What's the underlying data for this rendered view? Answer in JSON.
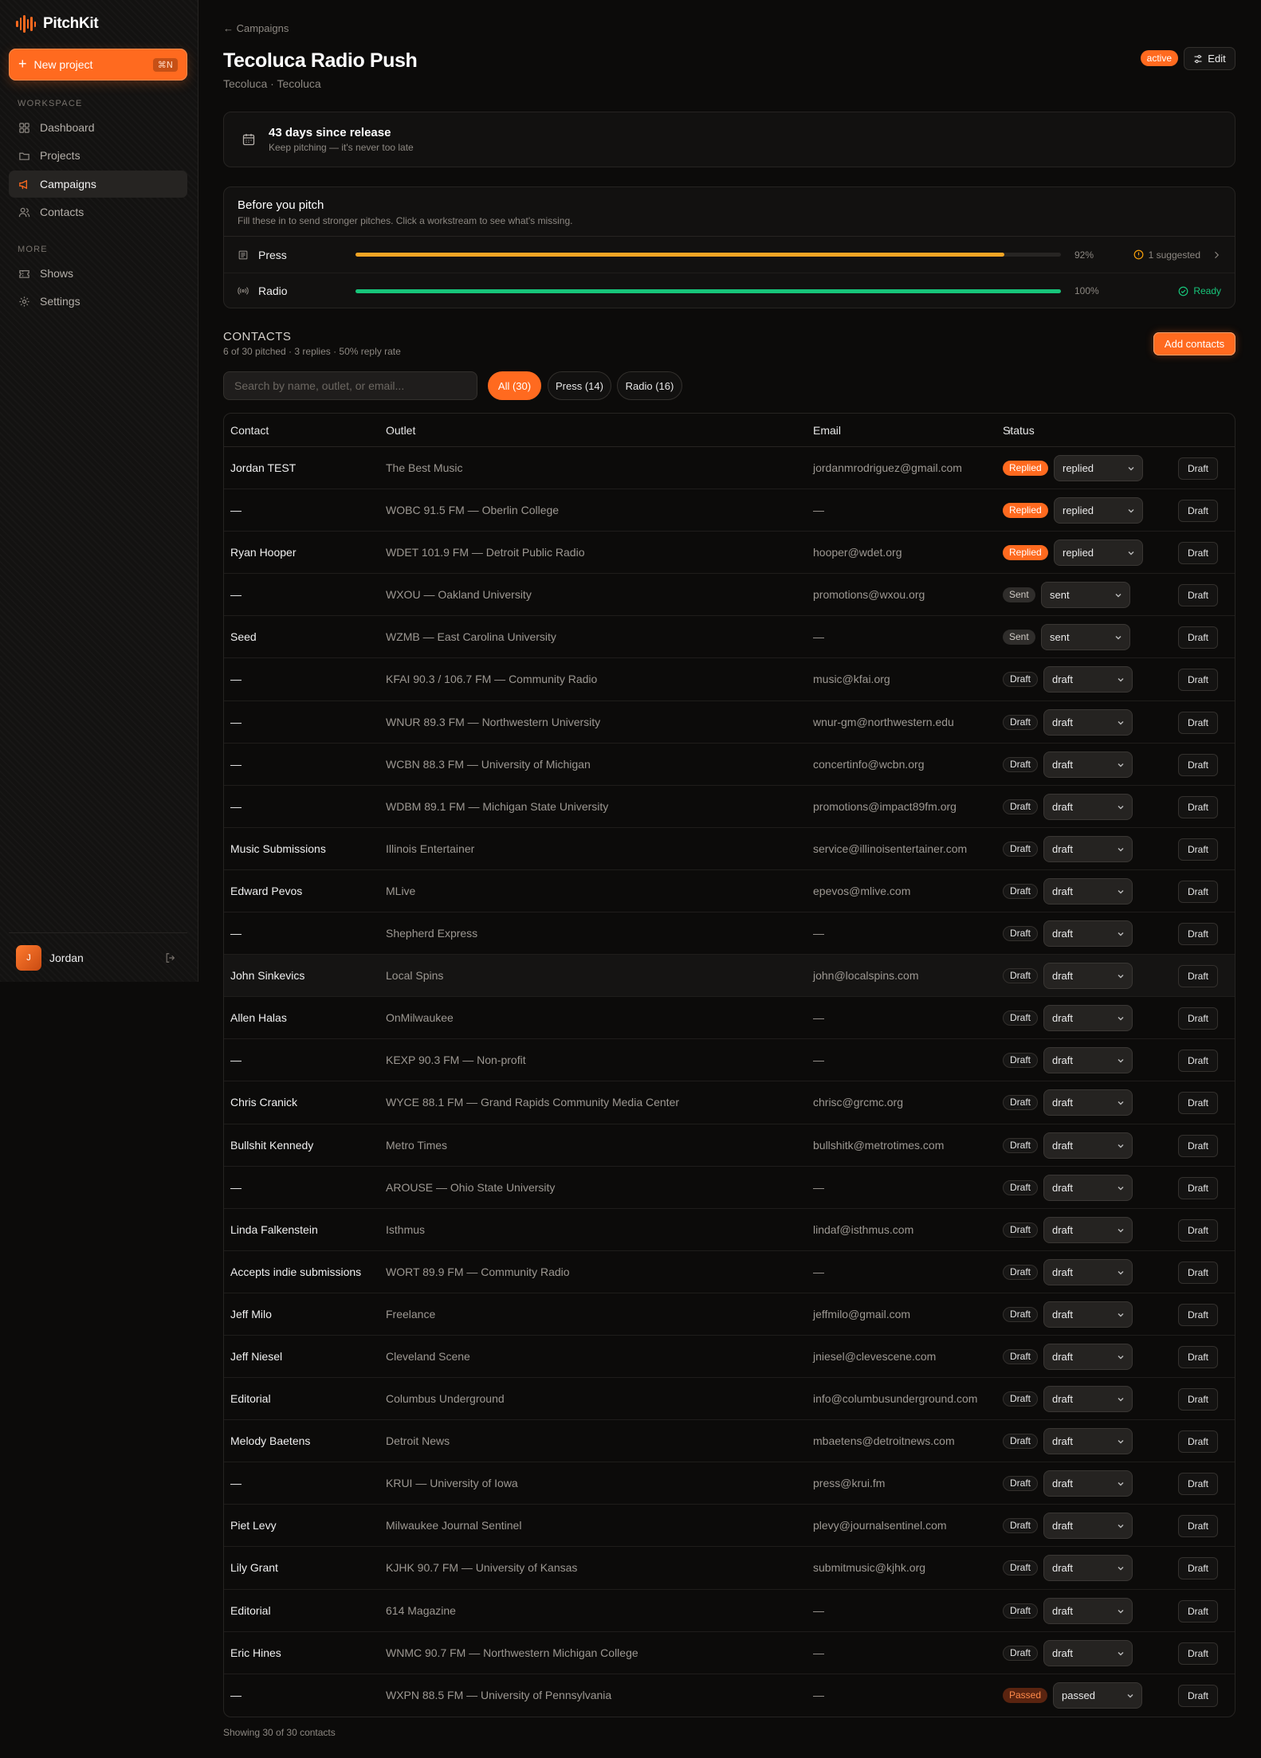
{
  "app": {
    "name": "PitchKit"
  },
  "sidebar": {
    "new_project": "New project",
    "new_project_kbd": "⌘N",
    "workspace_label": "WORKSPACE",
    "more_label": "MORE",
    "items": [
      {
        "label": "Dashboard",
        "icon": "grid-icon"
      },
      {
        "label": "Projects",
        "icon": "folder-icon"
      },
      {
        "label": "Campaigns",
        "icon": "megaphone-icon",
        "active": true
      },
      {
        "label": "Contacts",
        "icon": "users-icon"
      },
      {
        "label": "Shows",
        "icon": "ticket-icon"
      },
      {
        "label": "Settings",
        "icon": "gear-icon"
      }
    ],
    "user": {
      "initial": "J",
      "name": "Jordan"
    }
  },
  "header": {
    "breadcrumb": "← Campaigns",
    "title": "Tecoluca Radio Push",
    "subtitle": "Tecoluca · Tecoluca",
    "status_badge": "active",
    "edit_label": "Edit"
  },
  "release": {
    "title": "43 days since release",
    "subtitle": "Keep pitching — it's never too late"
  },
  "before_pitch": {
    "title": "Before you pitch",
    "subtitle": "Fill these in to send stronger pitches. Click a workstream to see what's missing.",
    "workstreams": [
      {
        "name": "Press",
        "percent": 92,
        "percent_label": "92%",
        "status": "1 suggested",
        "color": "#f5a524"
      },
      {
        "name": "Radio",
        "percent": 100,
        "percent_label": "100%",
        "status": "Ready",
        "color": "#17c57a"
      }
    ]
  },
  "contacts": {
    "heading": "CONTACTS",
    "summary": "6 of 30 pitched · 3 replies · 50% reply rate",
    "add_label": "Add contacts",
    "search_placeholder": "Search by name, outlet, or email...",
    "filters": [
      {
        "label": "All (30)",
        "active": true
      },
      {
        "label": "Press (14)",
        "active": false
      },
      {
        "label": "Radio (16)",
        "active": false
      }
    ],
    "columns": {
      "contact": "Contact",
      "outlet": "Outlet",
      "email": "Email",
      "status": "Status"
    },
    "draft_label": "Draft",
    "footer": "Showing 30 of 30 contacts",
    "rows": [
      {
        "contact": "Jordan TEST",
        "outlet": "The Best Music",
        "email": "jordanmrodriguez@gmail.com",
        "badge": "Replied",
        "select": "replied",
        "kind": "replied"
      },
      {
        "contact": "—",
        "outlet": "WOBC 91.5 FM — Oberlin College",
        "email": "—",
        "badge": "Replied",
        "select": "replied",
        "kind": "replied"
      },
      {
        "contact": "Ryan Hooper",
        "outlet": "WDET 101.9 FM — Detroit Public Radio",
        "email": "hooper@wdet.org",
        "badge": "Replied",
        "select": "replied",
        "kind": "replied"
      },
      {
        "contact": "—",
        "outlet": "WXOU — Oakland University",
        "email": "promotions@wxou.org",
        "badge": "Sent",
        "select": "sent",
        "kind": "sent"
      },
      {
        "contact": "Seed",
        "outlet": "WZMB — East Carolina University",
        "email": "—",
        "badge": "Sent",
        "select": "sent",
        "kind": "sent"
      },
      {
        "contact": "—",
        "outlet": "KFAI 90.3 / 106.7 FM — Community Radio",
        "email": "music@kfai.org",
        "badge": "Draft",
        "select": "draft",
        "kind": "draft"
      },
      {
        "contact": "—",
        "outlet": "WNUR 89.3 FM — Northwestern University",
        "email": "wnur-gm@northwestern.edu",
        "badge": "Draft",
        "select": "draft",
        "kind": "draft"
      },
      {
        "contact": "—",
        "outlet": "WCBN 88.3 FM — University of Michigan",
        "email": "concertinfo@wcbn.org",
        "badge": "Draft",
        "select": "draft",
        "kind": "draft"
      },
      {
        "contact": "—",
        "outlet": "WDBM 89.1 FM — Michigan State University",
        "email": "promotions@impact89fm.org",
        "badge": "Draft",
        "select": "draft",
        "kind": "draft"
      },
      {
        "contact": "Music Submissions",
        "outlet": "Illinois Entertainer",
        "email": "service@illinoisentertainer.com",
        "badge": "Draft",
        "select": "draft",
        "kind": "draft"
      },
      {
        "contact": "Edward Pevos",
        "outlet": "MLive",
        "email": "epevos@mlive.com",
        "badge": "Draft",
        "select": "draft",
        "kind": "draft"
      },
      {
        "contact": "—",
        "outlet": "Shepherd Express",
        "email": "—",
        "badge": "Draft",
        "select": "draft",
        "kind": "draft"
      },
      {
        "contact": "John Sinkevics",
        "outlet": "Local Spins",
        "email": "john@localspins.com",
        "badge": "Draft",
        "select": "draft",
        "kind": "draft"
      },
      {
        "contact": "Allen Halas",
        "outlet": "OnMilwaukee",
        "email": "—",
        "badge": "Draft",
        "select": "draft",
        "kind": "draft"
      },
      {
        "contact": "—",
        "outlet": "KEXP 90.3 FM — Non-profit",
        "email": "—",
        "badge": "Draft",
        "select": "draft",
        "kind": "draft"
      },
      {
        "contact": "Chris Cranick",
        "outlet": "WYCE 88.1 FM — Grand Rapids Community Media Center",
        "email": "chrisc@grcmc.org",
        "badge": "Draft",
        "select": "draft",
        "kind": "draft"
      },
      {
        "contact": "Bullshit Kennedy",
        "outlet": "Metro Times",
        "email": "bullshitk@metrotimes.com",
        "badge": "Draft",
        "select": "draft",
        "kind": "draft"
      },
      {
        "contact": "—",
        "outlet": "AROUSE — Ohio State University",
        "email": "—",
        "badge": "Draft",
        "select": "draft",
        "kind": "draft"
      },
      {
        "contact": "Linda Falkenstein",
        "outlet": "Isthmus",
        "email": "lindaf@isthmus.com",
        "badge": "Draft",
        "select": "draft",
        "kind": "draft"
      },
      {
        "contact": "Accepts indie submissions",
        "outlet": "WORT 89.9 FM — Community Radio",
        "email": "—",
        "badge": "Draft",
        "select": "draft",
        "kind": "draft"
      },
      {
        "contact": "Jeff Milo",
        "outlet": "Freelance",
        "email": "jeffmilo@gmail.com",
        "badge": "Draft",
        "select": "draft",
        "kind": "draft"
      },
      {
        "contact": "Jeff Niesel",
        "outlet": "Cleveland Scene",
        "email": "jniesel@clevescene.com",
        "badge": "Draft",
        "select": "draft",
        "kind": "draft"
      },
      {
        "contact": "Editorial",
        "outlet": "Columbus Underground",
        "email": "info@columbusunderground.com",
        "badge": "Draft",
        "select": "draft",
        "kind": "draft"
      },
      {
        "contact": "Melody Baetens",
        "outlet": "Detroit News",
        "email": "mbaetens@detroitnews.com",
        "badge": "Draft",
        "select": "draft",
        "kind": "draft"
      },
      {
        "contact": "—",
        "outlet": "KRUI — University of Iowa",
        "email": "press@krui.fm",
        "badge": "Draft",
        "select": "draft",
        "kind": "draft"
      },
      {
        "contact": "Piet Levy",
        "outlet": "Milwaukee Journal Sentinel",
        "email": "plevy@journalsentinel.com",
        "badge": "Draft",
        "select": "draft",
        "kind": "draft"
      },
      {
        "contact": "Lily Grant",
        "outlet": "KJHK 90.7 FM — University of Kansas",
        "email": "submitmusic@kjhk.org",
        "badge": "Draft",
        "select": "draft",
        "kind": "draft"
      },
      {
        "contact": "Editorial",
        "outlet": "614 Magazine",
        "email": "—",
        "badge": "Draft",
        "select": "draft",
        "kind": "draft"
      },
      {
        "contact": "Eric Hines",
        "outlet": "WNMC 90.7 FM — Northwestern Michigan College",
        "email": "—",
        "badge": "Draft",
        "select": "draft",
        "kind": "draft"
      },
      {
        "contact": "—",
        "outlet": "WXPN 88.5 FM — University of Pennsylvania",
        "email": "—",
        "badge": "Passed",
        "select": "passed",
        "kind": "passed"
      }
    ]
  },
  "colors": {
    "accent": "#ff6a1f",
    "press": "#f5a524",
    "radio": "#17c57a"
  }
}
